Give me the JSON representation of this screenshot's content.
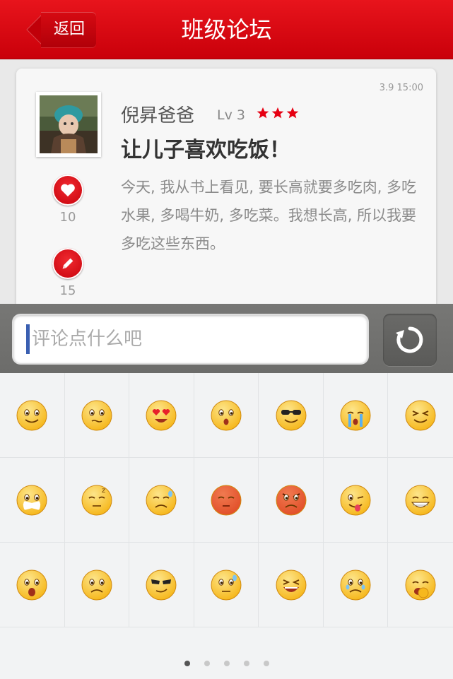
{
  "header": {
    "back_label": "返回",
    "title": "班级论坛"
  },
  "post": {
    "timestamp": "3.9 15:00",
    "author": "倪昇爸爸",
    "level": "Lv 3",
    "star_count": 3,
    "title": "让儿子喜欢吃饭！",
    "body": "今天, 我从书上看见, 要长高就要多吃肉, 多吃水果, 多喝牛奶, 多吃菜。我想长高, 所以我要多吃这些东西。",
    "like_count": "10",
    "comment_count": "15"
  },
  "comment": {
    "placeholder": "评论点什么吧"
  },
  "emojis": [
    "smile",
    "worried",
    "heart-eyes",
    "surprised",
    "cool-sunglasses",
    "crying",
    "squint",
    "taped-mouth",
    "sleepy",
    "sweat",
    "blush-red",
    "angry",
    "tongue-wink",
    "grin",
    "shocked",
    "sad",
    "sunglasses-smirk",
    "nervous-sweat",
    "laughing",
    "teary",
    "yawn"
  ],
  "pagination": {
    "pages": 5,
    "current": 1
  },
  "colors": {
    "brand_red": "#d4000c",
    "star_red": "#e60012",
    "caret_blue": "#3a5fb1"
  }
}
